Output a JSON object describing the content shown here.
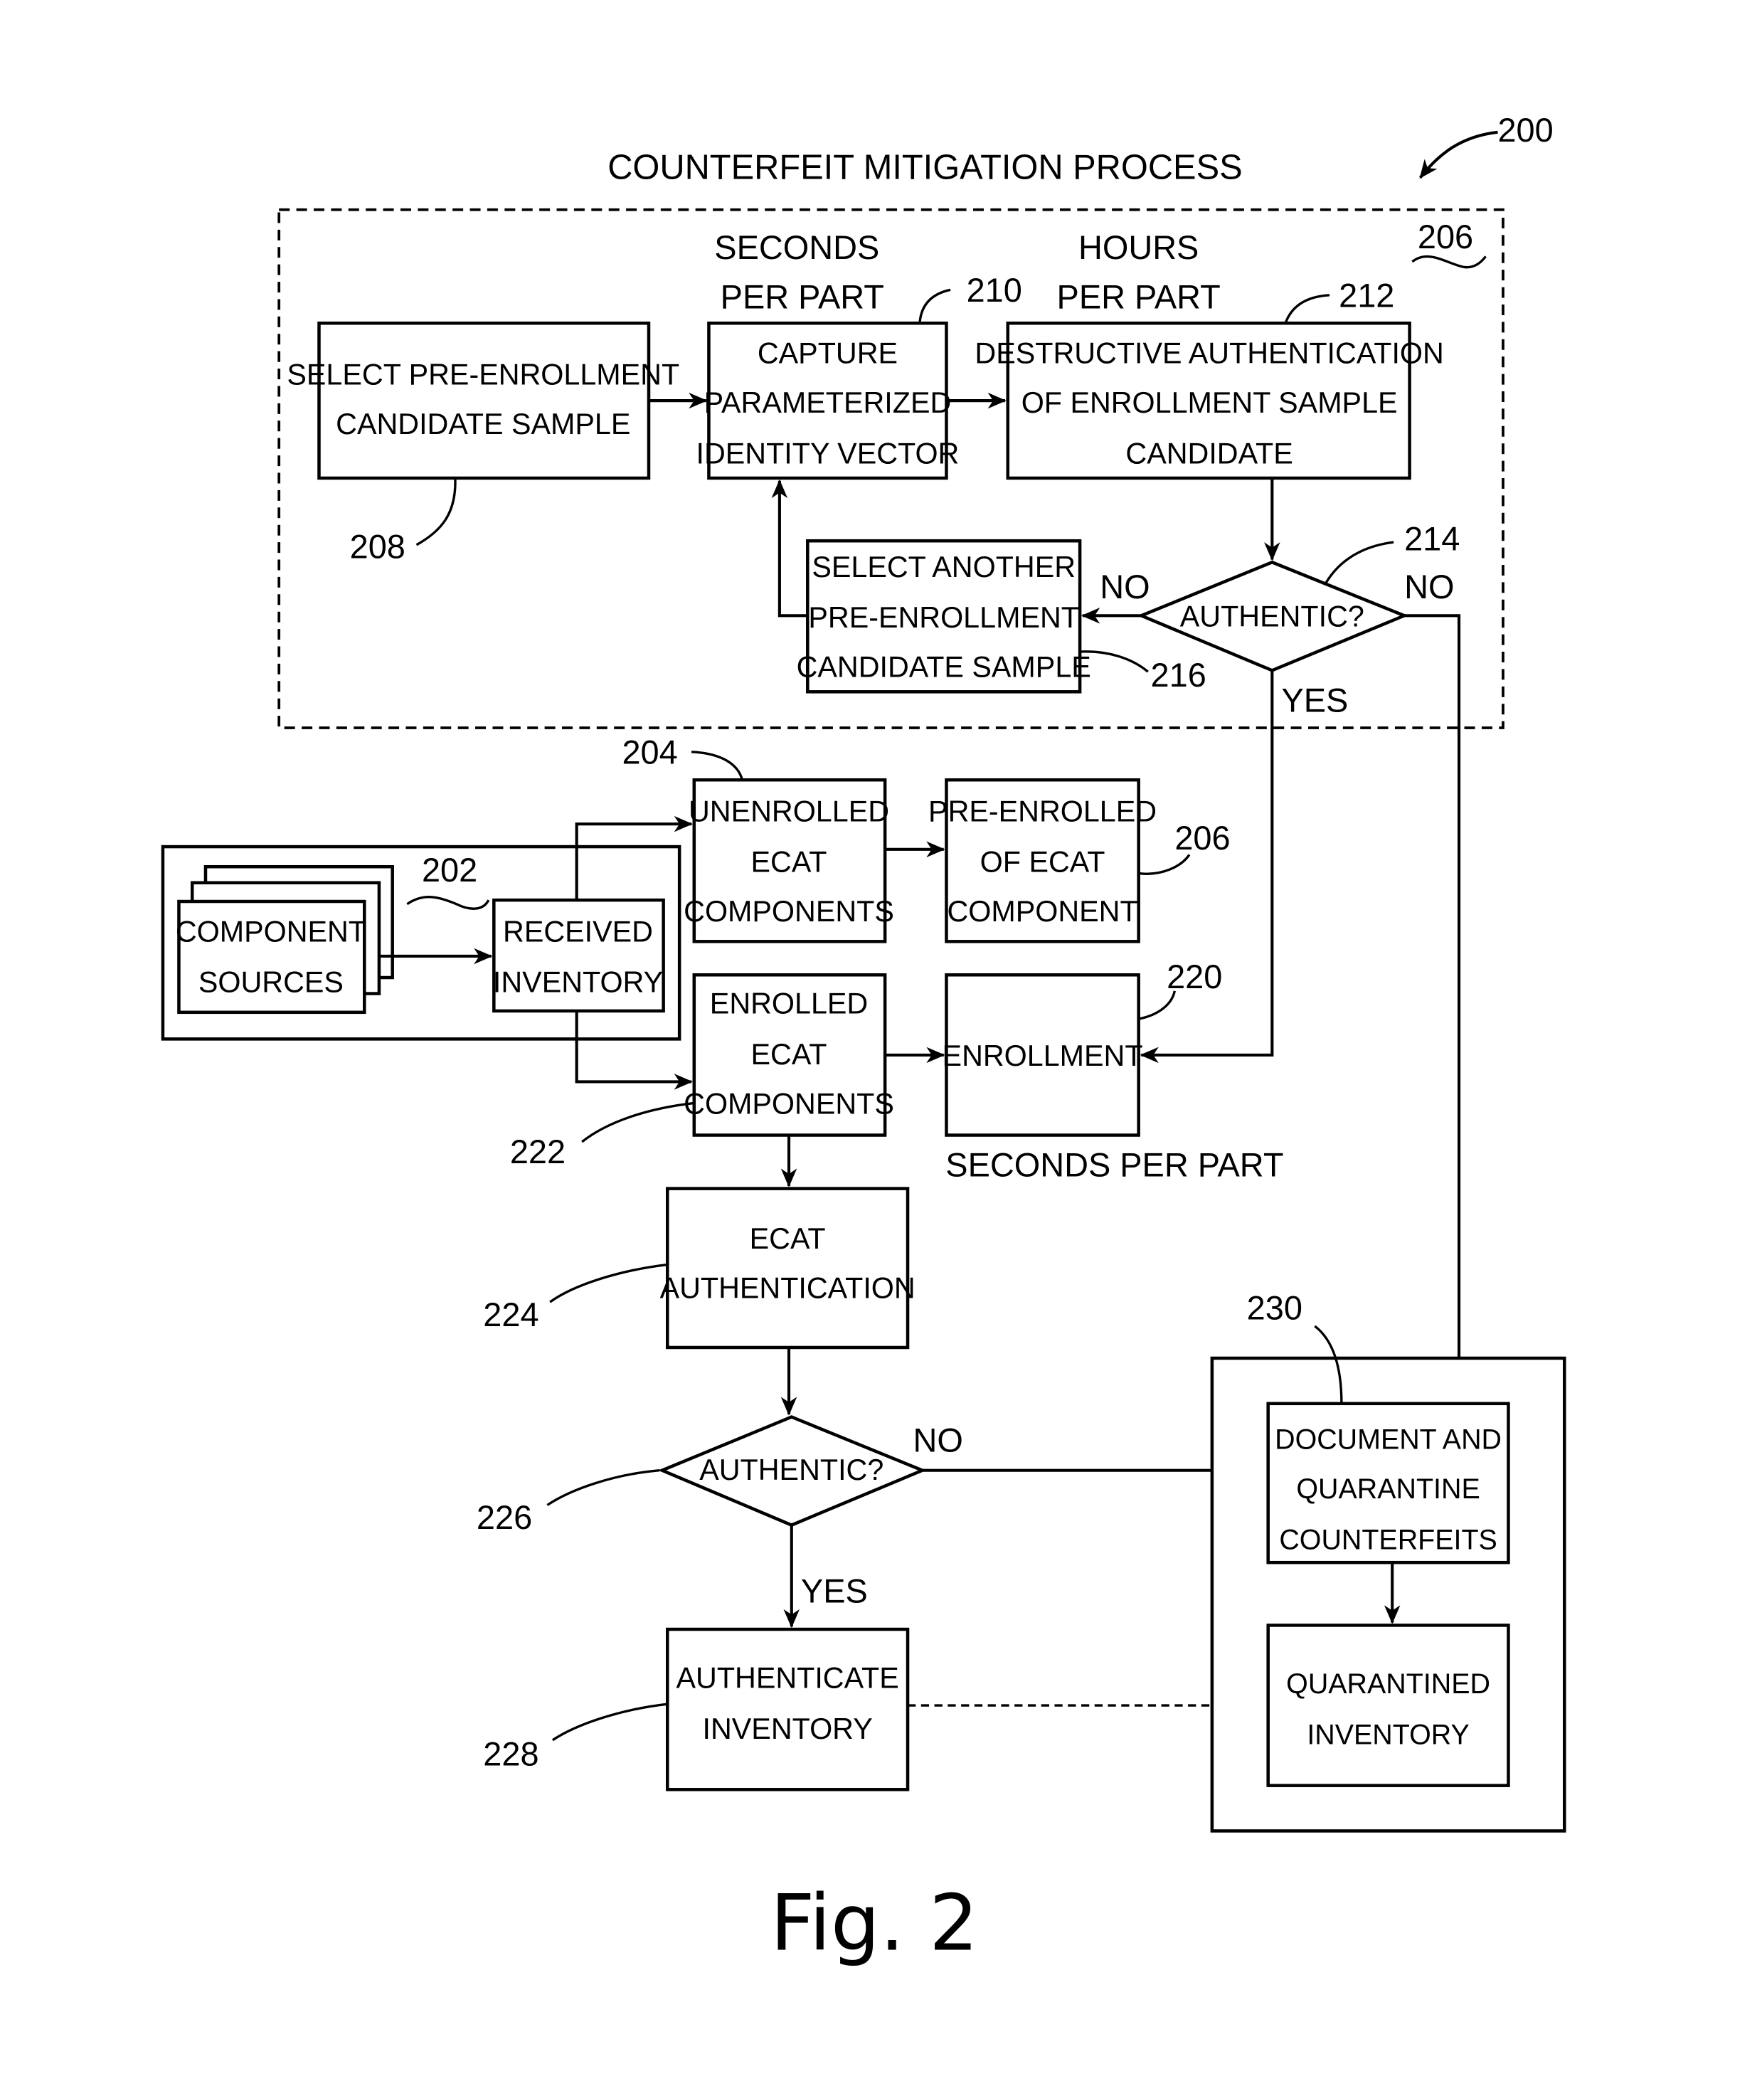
{
  "figure": {
    "title": "COUNTERFEIT MITIGATION PROCESS",
    "caption": "Fig. 2",
    "ref_main": "200"
  },
  "stage_labels": {
    "capture_rate_line1": "SECONDS",
    "capture_rate_line2": "PER PART",
    "destructive_rate_line1": "HOURS",
    "destructive_rate_line2": "PER PART",
    "enrollment_rate": "SECONDS PER PART"
  },
  "pre_enrollment_group": {
    "ref": "206"
  },
  "nodes": {
    "select_pre_enrollment": {
      "ref": "208",
      "lines": [
        "SELECT PRE-ENROLLMENT",
        "CANDIDATE SAMPLE"
      ]
    },
    "capture_vector": {
      "ref": "210",
      "lines": [
        "CAPTURE",
        "PARAMETERIZED",
        "IDENTITY VECTOR"
      ]
    },
    "destructive_auth": {
      "ref": "212",
      "lines": [
        "DESTRUCTIVE AUTHENTICATION",
        "OF ENROLLMENT SAMPLE",
        "CANDIDATE"
      ]
    },
    "authentic_check_1": {
      "ref": "214",
      "lines": [
        "AUTHENTIC?"
      ],
      "no_left": "NO",
      "no_right": "NO",
      "yes": "YES"
    },
    "select_another": {
      "ref": "216",
      "lines": [
        "SELECT ANOTHER",
        "PRE-ENROLLMENT",
        "CANDIDATE SAMPLE"
      ]
    },
    "inventory_group": {
      "ref": "202"
    },
    "component_sources": {
      "lines": [
        "COMPONENT",
        "SOURCES"
      ]
    },
    "received_inventory": {
      "lines": [
        "RECEIVED",
        "INVENTORY"
      ]
    },
    "unenrolled": {
      "ref": "204",
      "lines": [
        "UNENROLLED",
        "ECAT",
        "COMPONENTS"
      ]
    },
    "pre_enrolled": {
      "ref": "206",
      "lines": [
        "PRE-ENROLLED",
        "OF ECAT",
        "COMPONENT"
      ]
    },
    "enrolled": {
      "ref": "222",
      "lines": [
        "ENROLLED",
        "ECAT",
        "COMPONENTS"
      ]
    },
    "enrollment": {
      "ref": "220",
      "lines": [
        "ENROLLMENT"
      ]
    },
    "ecat_auth": {
      "ref": "224",
      "lines": [
        "ECAT",
        "AUTHENTICATION"
      ]
    },
    "authentic_check_2": {
      "ref": "226",
      "lines": [
        "AUTHENTIC?"
      ],
      "no": "NO",
      "yes": "YES"
    },
    "authenticate_inventory": {
      "ref": "228",
      "lines": [
        "AUTHENTICATE",
        "INVENTORY"
      ]
    },
    "quarantine_group": {
      "ref": "230"
    },
    "document_quarantine": {
      "lines": [
        "DOCUMENT AND",
        "QUARANTINE",
        "COUNTERFEITS"
      ]
    },
    "quarantined_inventory": {
      "lines": [
        "QUARANTINED",
        "INVENTORY"
      ]
    }
  }
}
